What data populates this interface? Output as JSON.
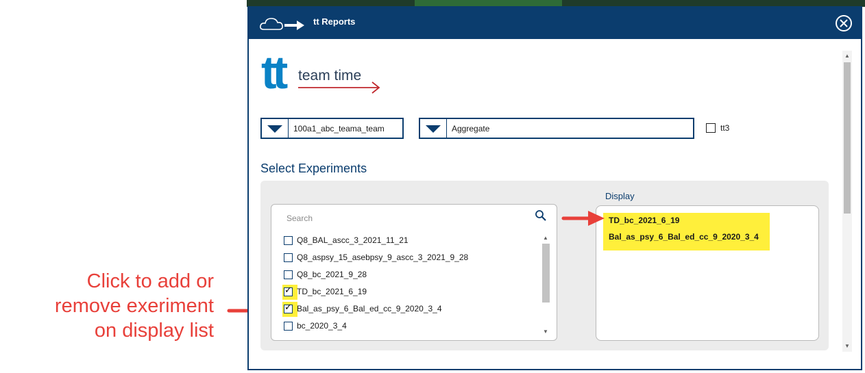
{
  "dialog": {
    "title": "tt Reports",
    "logo_text": "team time",
    "logo_letters": "tt"
  },
  "filters": {
    "team_value": "100a1_abc_teama_team",
    "mode_value": "Aggregate",
    "tt3_label": "tt3",
    "tt3_checked": false
  },
  "experiments": {
    "section_title": "Select Experiments",
    "search_placeholder": "Search",
    "items": [
      {
        "label": "Q8_BAL_ascc_3_2021_11_21",
        "checked": false
      },
      {
        "label": "Q8_aspsy_15_asebpsy_9_ascc_3_2021_9_28",
        "checked": false
      },
      {
        "label": "Q8_bc_2021_9_28",
        "checked": false
      },
      {
        "label": "TD_bc_2021_6_19",
        "checked": true
      },
      {
        "label": "Bal_as_psy_6_Bal_ed_cc_9_2020_3_4",
        "checked": true
      },
      {
        "label": "bc_2020_3_4",
        "checked": false
      }
    ]
  },
  "display": {
    "title": "Display",
    "items": [
      "TD_bc_2021_6_19",
      "Bal_as_psy_6_Bal_ed_cc_9_2020_3_4"
    ]
  },
  "annotation": {
    "lines": [
      "Click to add or",
      "remove exeriment",
      "on display list"
    ],
    "color": "#e8403a"
  },
  "colors": {
    "brand_navy": "#0b3d6e",
    "logo_blue": "#0a82c6",
    "highlight": "#ffef3b"
  }
}
